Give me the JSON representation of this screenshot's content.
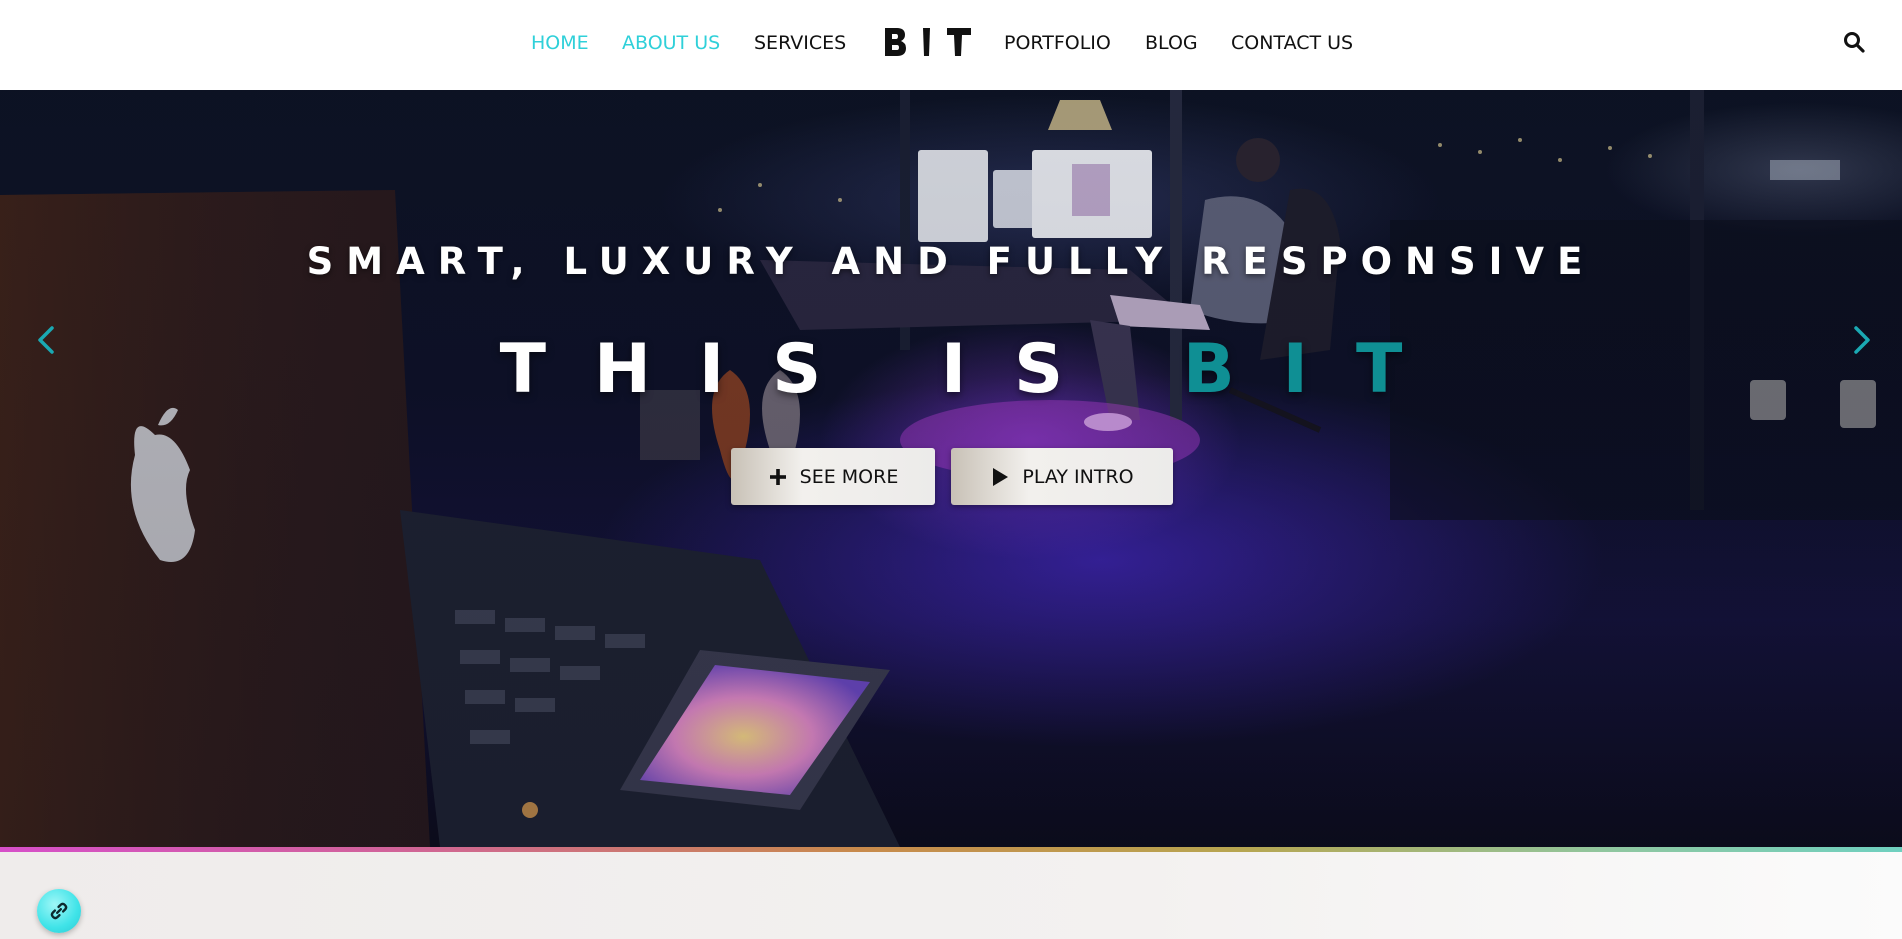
{
  "nav": {
    "items": [
      {
        "label": "HOME",
        "active": true
      },
      {
        "label": "ABOUT US",
        "active": true
      },
      {
        "label": "SERVICES",
        "active": false
      },
      {
        "label": "PORTFOLIO",
        "active": false
      },
      {
        "label": "BLOG",
        "active": false
      },
      {
        "label": "CONTACT US",
        "active": false
      }
    ],
    "logo_text": "BIT",
    "search_icon": "search-icon"
  },
  "hero": {
    "tagline": "SMART, LUXURY AND FULLY RESPONSIVE",
    "headline_prefix": "THIS IS",
    "headline_accent": "BIT",
    "buttons": [
      {
        "label": "SEE MORE",
        "icon": "plus-icon"
      },
      {
        "label": "PLAY INTRO",
        "icon": "play-icon"
      }
    ],
    "prev_icon": "chevron-left-icon",
    "next_icon": "chevron-right-icon"
  },
  "floating": {
    "icon": "link-icon"
  },
  "colors": {
    "accent": "#2fd0d9",
    "headline_accent": "#0f8f94",
    "header_bg": "#ffffff",
    "strip_start": "#d64fc9",
    "strip_end": "#6fd0c0"
  }
}
